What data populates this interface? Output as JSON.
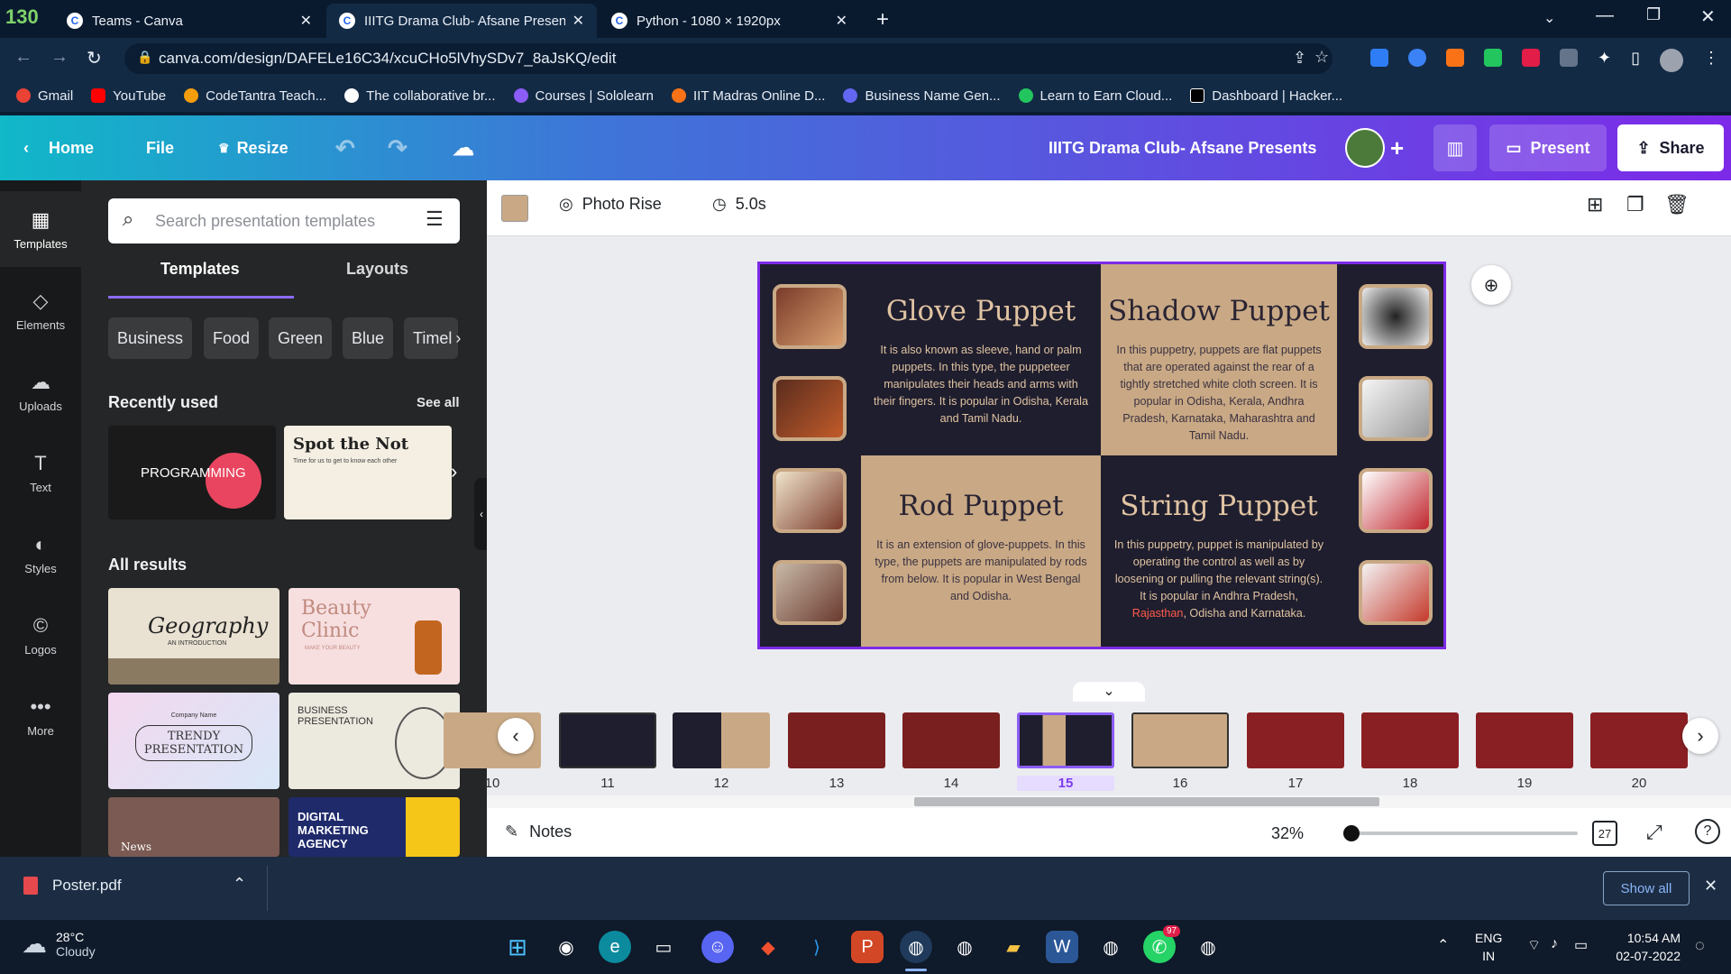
{
  "browser": {
    "profile_badge": "130",
    "tabs": [
      {
        "title": "Teams - Canva"
      },
      {
        "title": "IIITG Drama Club- Afsane Present"
      },
      {
        "title": "Python - 1080 × 1920px"
      }
    ],
    "url": "canva.com/design/DAFELe16C34/xcuCHo5lVhySDv7_8aJsKQ/edit",
    "bookmarks": [
      "Gmail",
      "YouTube",
      "CodeTantra Teach...",
      "The collaborative br...",
      "Courses | Sololearn",
      "IIT Madras Online D...",
      "Business Name Gen...",
      "Learn to Earn Cloud...",
      "Dashboard | Hacker..."
    ]
  },
  "canva_bar": {
    "home": "Home",
    "file": "File",
    "resize": "Resize",
    "design_title": "IIITG Drama Club- Afsane Presents",
    "present": "Present",
    "share": "Share"
  },
  "rail": [
    {
      "label": "Templates",
      "icon": "▦"
    },
    {
      "label": "Elements",
      "icon": "◇"
    },
    {
      "label": "Uploads",
      "icon": "☁"
    },
    {
      "label": "Text",
      "icon": "T"
    },
    {
      "label": "Styles",
      "icon": "◐"
    },
    {
      "label": "Logos",
      "icon": "©"
    },
    {
      "label": "More",
      "icon": "•••"
    }
  ],
  "panel": {
    "search_placeholder": "Search presentation templates",
    "tab_templates": "Templates",
    "tab_layouts": "Layouts",
    "chips": [
      "Business",
      "Food",
      "Green",
      "Blue",
      "Timel"
    ],
    "recently_used": "Recently used",
    "see_all": "See all",
    "recent": [
      {
        "label": "PROGRAMMING"
      },
      {
        "label": "Spot the Not",
        "sub": "Time for us to get to know each other"
      }
    ],
    "all_results": "All results",
    "results": [
      {
        "label": "Geography",
        "sub": "AN INTRODUCTION"
      },
      {
        "label": "Beauty Clinic",
        "sub": "MAKE YOUR BEAUTY"
      },
      {
        "label": "TRENDY PRESENTATION",
        "sub": "Company Name"
      },
      {
        "label": "BUSINESS PRESENTATION"
      },
      {
        "label": "News"
      },
      {
        "label": "DIGITAL MARKETING AGENCY"
      }
    ]
  },
  "toolbar": {
    "animation": "Photo Rise",
    "duration": "5.0s",
    "color_swatch": "#c9a985"
  },
  "slide": {
    "glove": {
      "title": "Glove Puppet",
      "body": "It is also known as sleeve, hand or palm puppets. In this type, the puppeteer manipulates their heads and arms with their fingers. It is popular in Odisha, Kerala and Tamil Nadu."
    },
    "shadow": {
      "title": "Shadow Puppet",
      "body": "In this puppetry, puppets are flat puppets that are operated against the rear of a tightly stretched white cloth screen. It is popular in Odisha, Kerala, Andhra Pradesh, Karnataka, Maharashtra and Tamil Nadu."
    },
    "rod": {
      "title": "Rod Puppet",
      "body": "It is an extension of glove-puppets. In this type, the puppets are manipulated by rods from below. It is popular in West Bengal and Odisha."
    },
    "string": {
      "title": "String Puppet",
      "body_pre": "In this puppetry, puppet is manipulated by operating the control as well as by loosening or pulling the relevant string(s). It is popular in Andhra Pradesh, ",
      "body_highlight": "Rajasthan",
      "body_post": ", Odisha and Karnataka."
    }
  },
  "filmstrip": {
    "pages": [
      "10",
      "11",
      "12",
      "13",
      "14",
      "15",
      "16",
      "17",
      "18",
      "19",
      "20"
    ],
    "current": "15"
  },
  "footer": {
    "notes": "Notes",
    "zoom": "32%",
    "page_count": "27",
    "download_file": "Poster.pdf",
    "show_all": "Show all"
  },
  "taskbar": {
    "temp": "28°C",
    "weather": "Cloudy",
    "lang": "ENG",
    "region": "IN",
    "time": "10:54 AM",
    "date": "02-07-2022",
    "whatsapp_badge": "97"
  }
}
